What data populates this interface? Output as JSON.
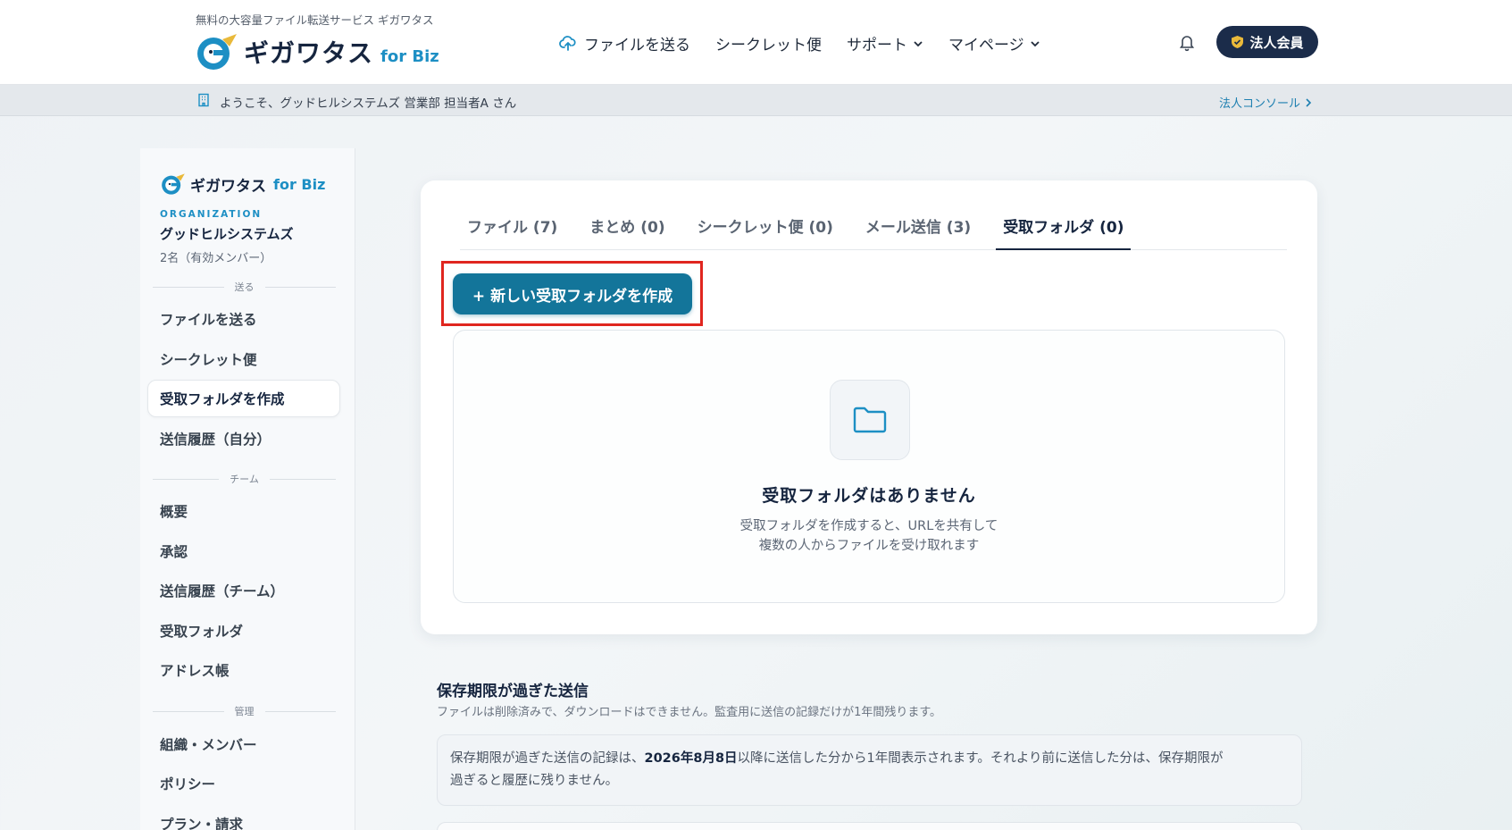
{
  "header": {
    "tagline": "無料の大容量ファイル転送サービス ギガワタス",
    "logo_text": "ギガワタス",
    "logo_biz": "for Biz",
    "nav": {
      "send": "ファイルを送る",
      "secret": "シークレット便",
      "support": "サポート",
      "mypage": "マイページ"
    },
    "corp_button": "法人会員"
  },
  "welcome": {
    "message": "ようこそ、グッドヒルシステムズ 営業部 担当者A さん",
    "console_link": "法人コンソール"
  },
  "sidebar": {
    "logo_text": "ギガワタス",
    "logo_biz": "for Biz",
    "org_label": "ORGANIZATION",
    "org_name": "グッドヒルシステムズ",
    "org_members": "2名（有効メンバー）",
    "section_send": "送る",
    "items_send": [
      "ファイルを送る",
      "シークレット便",
      "受取フォルダを作成",
      "送信履歴（自分）"
    ],
    "section_team": "チーム",
    "items_team": [
      "概要",
      "承認",
      "送信履歴（チーム）",
      "受取フォルダ",
      "アドレス帳"
    ],
    "section_admin": "管理",
    "items_admin": [
      "組織・メンバー",
      "ポリシー",
      "プラン・請求"
    ]
  },
  "tabs": [
    "ファイル (7)",
    "まとめ (0)",
    "シークレット便 (0)",
    "メール送信 (3)",
    "受取フォルダ (0)"
  ],
  "create_button": "+ 新しい受取フォルダを作成",
  "empty_state": {
    "title": "受取フォルダはありません",
    "desc_line1": "受取フォルダを作成すると、URLを共有して",
    "desc_line2": "複数の人からファイルを受け取れます"
  },
  "expired": {
    "title": "保存期限が過ぎた送信",
    "subtitle": "ファイルは削除済みで、ダウンロードはできません。監査用に送信の記録だけが1年間残ります。",
    "notice_pre": "保存期限が過ぎた送信の記録は、",
    "notice_date": "2026年8月8日",
    "notice_post": "以降に送信した分から1年間表示されます。それより前に送信した分は、保存期限が",
    "notice_line2": "過ぎると履歴に残りません。"
  },
  "colors": {
    "brand_navy": "#16253f",
    "brand_blue": "#1d8fc4",
    "button_teal": "#13759a",
    "highlight_red": "#e0261f"
  }
}
